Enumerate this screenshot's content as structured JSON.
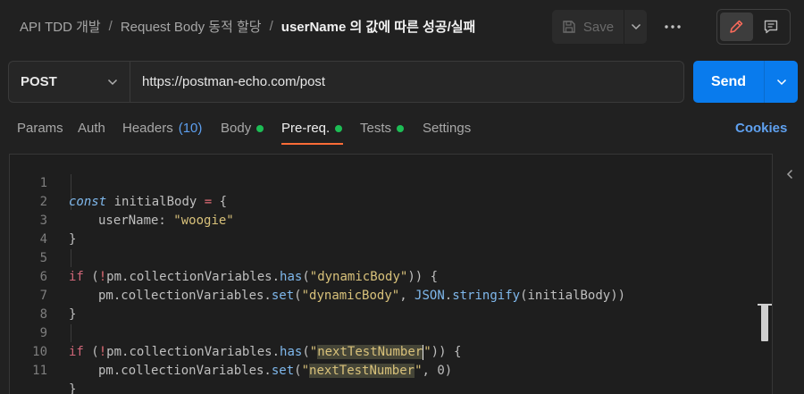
{
  "breadcrumb": {
    "items": [
      "API TDD 개발",
      "Request Body 동적 할당"
    ],
    "separator": "/",
    "current": "userName 의 값에 따른 성공/실패"
  },
  "toolbar": {
    "save_label": "Save",
    "icons": [
      "save-icon",
      "chevron-down-icon",
      "more-icon",
      "edit-icon",
      "comment-icon"
    ]
  },
  "request": {
    "method": "POST",
    "url": "https://postman-echo.com/post",
    "send_label": "Send"
  },
  "tabs": [
    {
      "label": "Params"
    },
    {
      "label": "Auth"
    },
    {
      "label": "Headers",
      "count": "(10)"
    },
    {
      "label": "Body",
      "dot": true
    },
    {
      "label": "Pre-req.",
      "dot": true,
      "active": true
    },
    {
      "label": "Tests",
      "dot": true
    },
    {
      "label": "Settings"
    }
  ],
  "cookies_label": "Cookies",
  "editor": {
    "line_numbers": [
      "1",
      "2",
      "3",
      "4",
      "5",
      "6",
      "7",
      "8",
      "9",
      "10",
      "11"
    ],
    "code": {
      "l1": {
        "kw": "const",
        "name": " initialBody ",
        "op": "=",
        "brace": " {"
      },
      "l2": {
        "key": "userName: ",
        "val": "\"woogie\""
      },
      "l3": {
        "brace": "}"
      },
      "l5": {
        "kw": "if",
        "p1": " (",
        "not": "!",
        "obj": "pm.collectionVariables.",
        "fn": "has",
        "p2": "(",
        "str": "\"dynamicBody\"",
        "p3": ")) {"
      },
      "l6": {
        "obj": "pm.collectionVariables.",
        "fn": "set",
        "p1": "(",
        "str": "\"dynamicBody\"",
        "comma": ", ",
        "json": "JSON",
        "dot": ".",
        "fn2": "stringify",
        "p2": "(initialBody))"
      },
      "l7": {
        "brace": "}"
      },
      "l9": {
        "kw": "if",
        "p1": " (",
        "not": "!",
        "obj": "pm.collectionVariables.",
        "fn": "has",
        "p2": "(",
        "q1": "\"",
        "hl": "nextTestNumber",
        "q2": "\"",
        "p3": ")) {"
      },
      "l10": {
        "obj": "pm.collectionVariables.",
        "fn": "set",
        "p1": "(",
        "q1": "\"",
        "hl": "nextTestNumber",
        "q2": "\"",
        "rest": ", 0)"
      },
      "l11": {
        "brace": "}"
      }
    }
  },
  "colors": {
    "accent_orange": "#ff6c37",
    "send_blue": "#097bed",
    "status_green": "#1dbd55",
    "link_blue": "#5fa1f0"
  }
}
